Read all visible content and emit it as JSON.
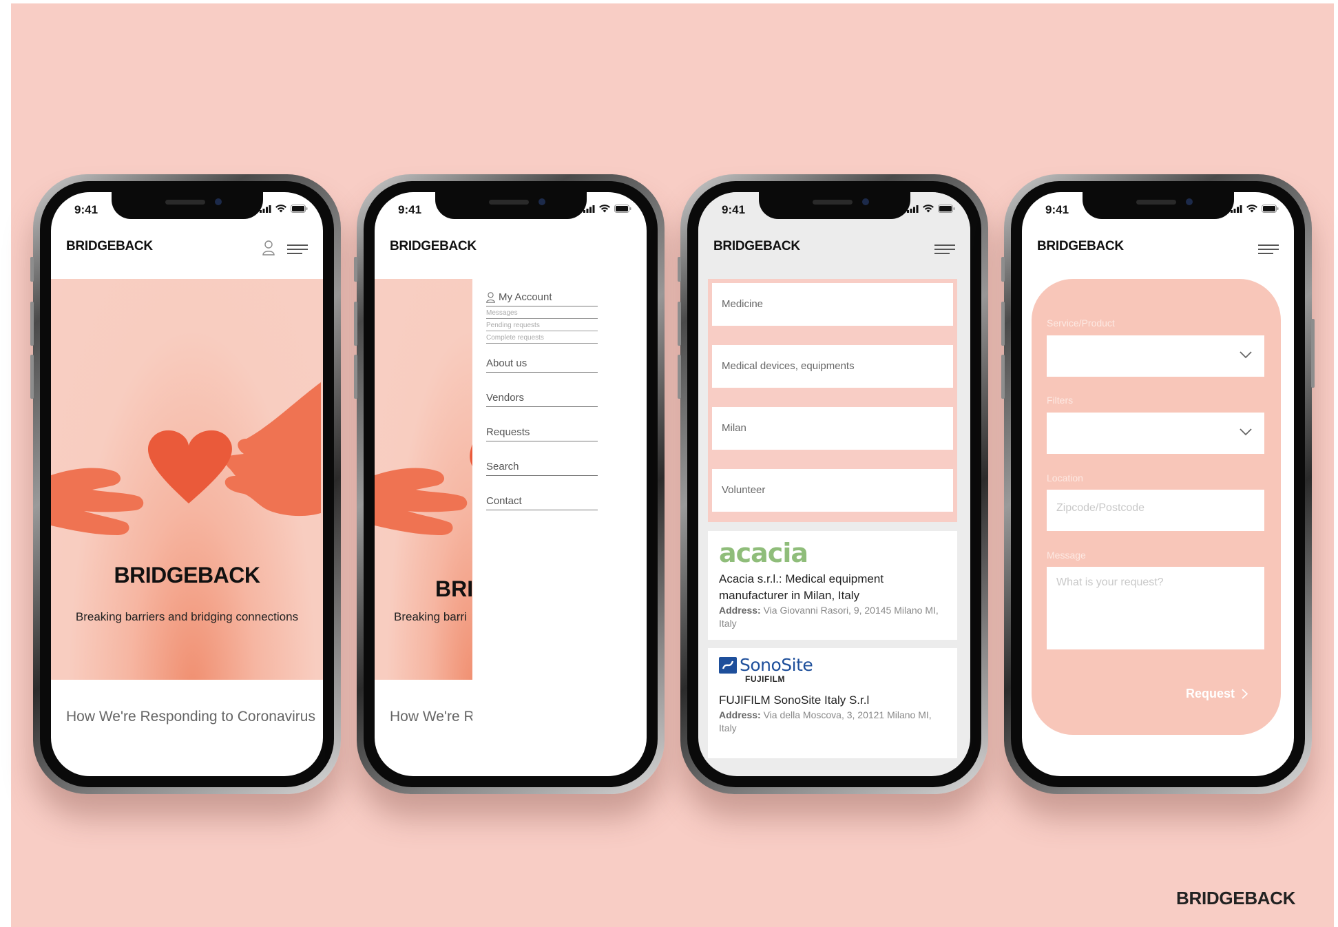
{
  "colors": {
    "background": "#f8cdc5",
    "accent": "#f8c6b9",
    "heart": "#ea5a3a",
    "text": "#222222"
  },
  "status_bar": {
    "time": "9:41"
  },
  "brand": {
    "name": "BRIDGEBACK"
  },
  "home": {
    "hero_title": "BRIDGEBACK",
    "hero_subtitle": "Breaking barriers and bridging connections",
    "footer_link": "How We're Responding to Coronavirus"
  },
  "menu_screen": {
    "hero_title_partial": "BRI",
    "hero_subtitle_partial": "Breaking barri",
    "footer_partial": "How We're R",
    "account": {
      "label": "My Account",
      "sub_items": [
        "Messages",
        "Pending requests",
        "Complete requests"
      ]
    },
    "items": [
      "About us",
      "Vendors",
      "Requests",
      "Search",
      "Contact"
    ]
  },
  "results_screen": {
    "filters": [
      "Medicine",
      "Medical devices, equipments",
      "Milan",
      "Volunteer"
    ],
    "results": [
      {
        "logo_text": "acacia",
        "title": "Acacia s.r.l.: Medical equipment manufacturer in Milan, Italy",
        "address_label": "Address:",
        "address_value": "Via Giovanni Rasori, 9, 20145 Milano MI, Italy"
      },
      {
        "logo_text": "SonoSite",
        "logo_subtext": "FUJIFILM",
        "title": "FUJIFILM SonoSite Italy S.r.l",
        "address_label": "Address:",
        "address_value": "Via della Moscova, 3, 20121 Milano MI, Italy"
      }
    ]
  },
  "request_screen": {
    "service_label": "Service/Product",
    "filters_label": "Filters",
    "location_label": "Location",
    "location_placeholder": "Zipcode/Postcode",
    "message_label": "Message",
    "message_placeholder": "What is your request?",
    "submit_label": "Request"
  },
  "icons": [
    "user-icon",
    "hamburger-menu-icon",
    "signal-icon",
    "wifi-icon",
    "battery-icon",
    "chevron-down-icon",
    "chevron-right-icon"
  ]
}
